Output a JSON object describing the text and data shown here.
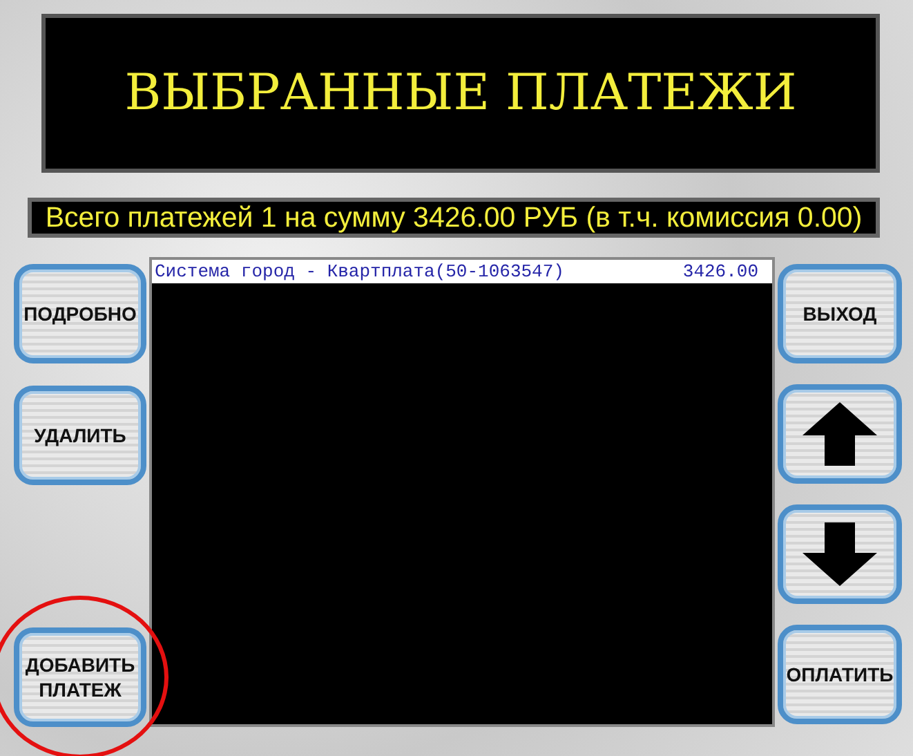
{
  "title": "ВЫБРАННЫЕ ПЛАТЕЖИ",
  "summary": "Всего платежей 1 на сумму 3426.00 РУБ (в т.ч. комиссия 0.00)",
  "left_buttons": [
    {
      "kind": "text",
      "label": "ПОДРОБНО"
    },
    {
      "kind": "text",
      "label": "УДАЛИТЬ"
    },
    {
      "kind": "text",
      "label": "ДОБАВИТЬ ПЛАТЕЖ",
      "highlighted": true
    }
  ],
  "payments": [
    {
      "name": "Система город - Квартплата(50-1063547)",
      "amount": "3426.00",
      "selected": true
    }
  ],
  "right_buttons": [
    {
      "kind": "text",
      "label": "ВЫХОД"
    },
    {
      "kind": "up"
    },
    {
      "kind": "down"
    },
    {
      "kind": "text",
      "label": "ОПЛАТИТЬ"
    }
  ]
}
